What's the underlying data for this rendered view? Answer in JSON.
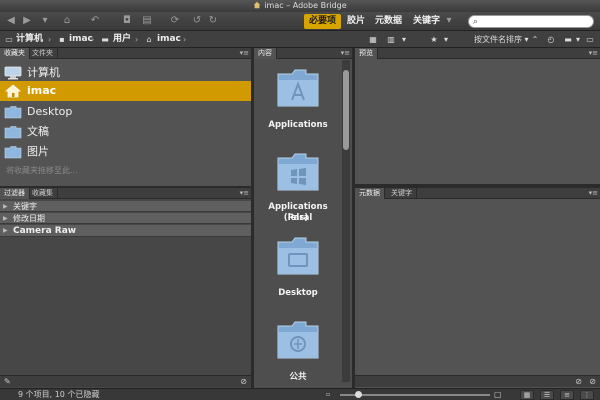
{
  "window": {
    "title": "imac – Adobe Bridge"
  },
  "toolbar": {
    "workspaces": [
      {
        "label": "必要项",
        "active": true
      },
      {
        "label": "胶片",
        "active": false
      },
      {
        "label": "元数据",
        "active": false
      },
      {
        "label": "关键字",
        "active": false
      }
    ],
    "search": {
      "value": "",
      "placeholder": ""
    }
  },
  "pathbar": {
    "crumbs": [
      "计算机",
      "imac",
      "用户",
      "imac"
    ],
    "sort_label": "按文件名排序"
  },
  "favorites_panel": {
    "tabs": [
      "收藏夹",
      "文件夹"
    ],
    "items": [
      {
        "label": "计算机",
        "icon": "computer-icon"
      },
      {
        "label": "imac",
        "icon": "home-icon"
      },
      {
        "label": "Desktop",
        "icon": "folder-icon"
      },
      {
        "label": "文稿",
        "icon": "folder-icon"
      },
      {
        "label": "图片",
        "icon": "folder-icon"
      }
    ],
    "hint": "将收藏夹拖移至此..."
  },
  "filter_panel": {
    "tabs": [
      "过滤器",
      "收藏集"
    ],
    "rows": [
      "关键字",
      "修改日期"
    ],
    "camera_raw": "Camera Raw"
  },
  "content_panel": {
    "tab": "内容",
    "items": [
      {
        "name": "Applications",
        "icon": "applications-folder-icon"
      },
      {
        "name": "Applications (Parallels)",
        "name_line1": "Applications (Paral",
        "name_line2": "lels)",
        "icon": "windows-folder-icon"
      },
      {
        "name": "Desktop",
        "icon": "desktop-folder-icon"
      },
      {
        "name": "公共",
        "icon": "public-folder-icon"
      }
    ]
  },
  "preview_panel": {
    "tab": "预览"
  },
  "metadata_panel": {
    "tabs": [
      "元数据",
      "关键字"
    ]
  },
  "statusbar": {
    "text": "9 个项目, 10 个已隐藏"
  },
  "colors": {
    "accent": "#d7a400",
    "selected_row": "#d09a00",
    "panel_bg": "#535353",
    "folder_blue": "#8fb6dc"
  }
}
